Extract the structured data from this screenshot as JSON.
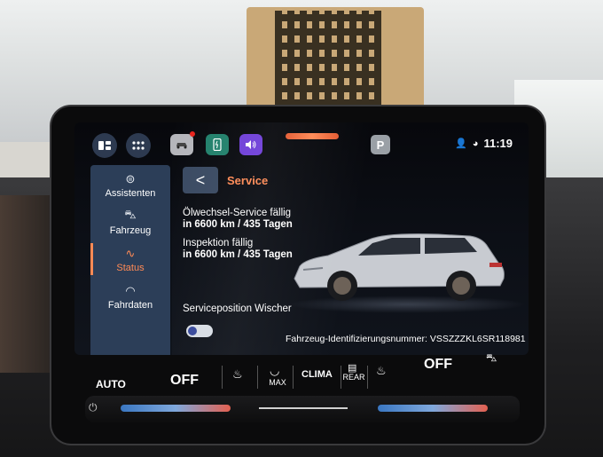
{
  "topbar": {
    "home_icon": "screens-icon",
    "apps_icon": "apps-grid-icon",
    "car_icon": "car-icon",
    "phone_icon": "phone-charge-icon",
    "sound_icon": "speaker-icon",
    "park_label": "P",
    "time": "11:19"
  },
  "sidebar": {
    "items": [
      {
        "label": "Assistenten",
        "icon": "assist-icon"
      },
      {
        "label": "Fahrzeug",
        "icon": "car-settings-icon"
      },
      {
        "label": "Status",
        "icon": "pulse-icon"
      },
      {
        "label": "Fahrdaten",
        "icon": "gauge-icon"
      }
    ]
  },
  "main": {
    "back_label": "<",
    "title": "Service",
    "oil_service_title": "Ölwechsel-Service fällig",
    "oil_service_value": "in 6600 km / 435 Tagen",
    "inspection_title": "Inspektion fällig",
    "inspection_value": "in 6600 km / 435 Tagen",
    "wiper_label": "Serviceposition Wischer",
    "wiper_toggle_on": false,
    "vin": "Fahrzeug-Identifizierungsnummer: VSSZZZKL6SR118981"
  },
  "climate": {
    "left_auto": "AUTO",
    "left_off": "OFF",
    "max": "MAX",
    "clima": "CLIMA",
    "rear": "REAR",
    "right_off": "OFF"
  },
  "colors": {
    "accent": "#ff8a55",
    "sidebar_bg": "#2c3e58",
    "phone_green": "#21806b",
    "sound_purple": "#6f3fd8"
  }
}
